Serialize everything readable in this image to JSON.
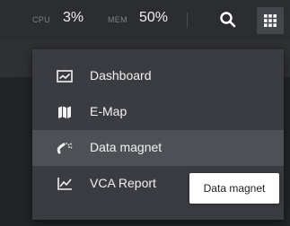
{
  "header": {
    "cpu_label": "CPU",
    "cpu_value": "3%",
    "mem_label": "MEM",
    "mem_value": "50%",
    "search_icon": "search-icon",
    "apps_icon": "grid-icon"
  },
  "menu": {
    "items": [
      {
        "label": "Dashboard",
        "icon": "dashboard-icon"
      },
      {
        "label": "E-Map",
        "icon": "map-icon"
      },
      {
        "label": "Data magnet",
        "icon": "magnet-icon",
        "active": true
      },
      {
        "label": "VCA Report",
        "icon": "chart-icon"
      }
    ]
  },
  "tooltip": {
    "text": "Data magnet"
  },
  "colors": {
    "background": "#222427",
    "topbar": "#2b2d31",
    "menu": "#3a3c41",
    "active_item": "#4d5055",
    "tooltip": "#ffffff"
  }
}
